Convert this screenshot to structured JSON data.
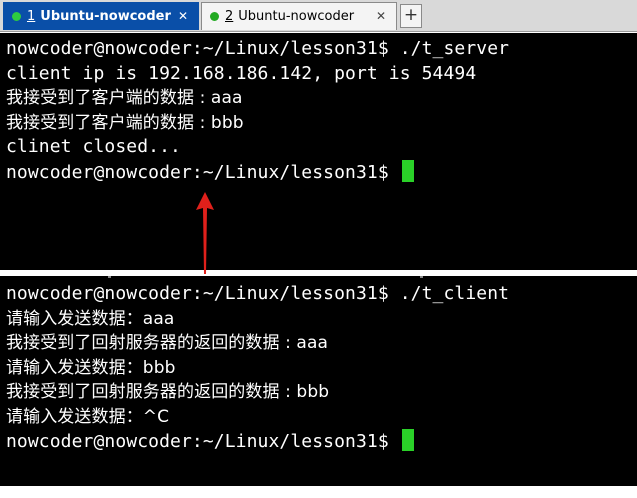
{
  "tabs": [
    {
      "number": "1",
      "title": "Ubuntu-nowcoder",
      "active": true,
      "dot_color": "#2ecc40",
      "close": "✕"
    },
    {
      "number": "2",
      "title": "Ubuntu-nowcoder",
      "active": false,
      "dot_color": "#22aa22",
      "close": "✕"
    }
  ],
  "new_tab_label": "+",
  "server_terminal": {
    "lines": [
      "nowcoder@nowcoder:~/Linux/lesson31$ ./t_server",
      "client ip is 192.168.186.142, port is 54494",
      "我接受到了客户端的数据 : aaa",
      "我接受到了客户端的数据 : bbb",
      "clinet closed...",
      "nowcoder@nowcoder:~/Linux/lesson31$ "
    ]
  },
  "client_terminal": {
    "lines": [
      "nowcoder@nowcoder:~/Linux/lesson31$ ./t_client",
      "请输入发送数据：aaa",
      "我接受到了回射服务器的返回的数据 : aaa",
      "请输入发送数据：bbb",
      "我接受到了回射服务器的返回的数据 : bbb",
      "请输入发送数据：^C",
      "nowcoder@nowcoder:~/Linux/lesson31$ "
    ]
  },
  "colors": {
    "cursor": "#2ad128",
    "arrow": "#e0201b",
    "active_tab": "#0a4fa8",
    "terminal_bg": "#000000",
    "terminal_fg": "#ffffff"
  }
}
